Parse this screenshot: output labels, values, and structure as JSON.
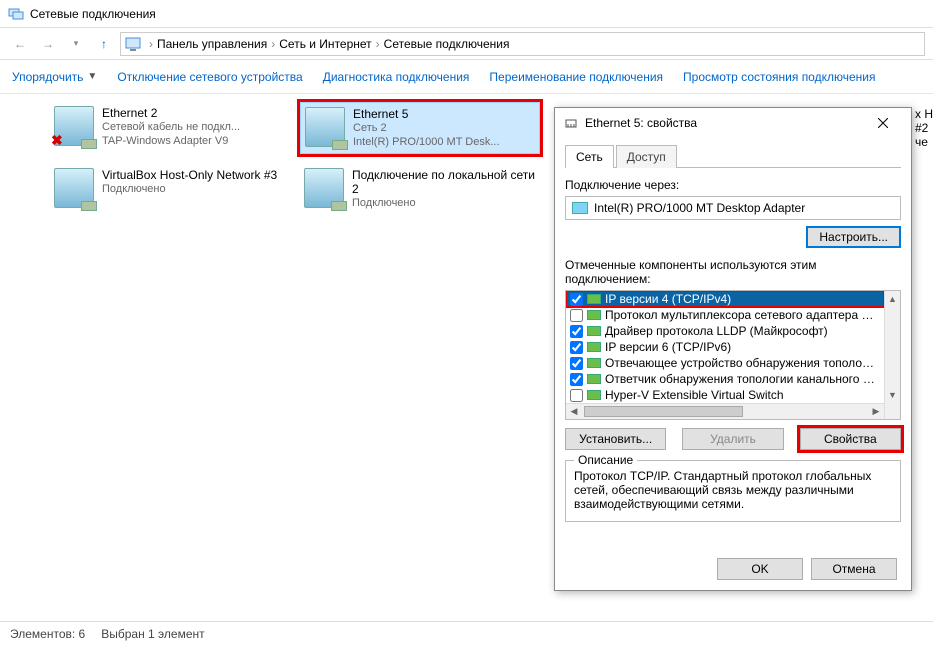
{
  "titlebar": {
    "title": "Сетевые подключения"
  },
  "breadcrumb": {
    "items": [
      "Панель управления",
      "Сеть и Интернет",
      "Сетевые подключения"
    ]
  },
  "cmdbar": {
    "organize": "Упорядочить",
    "disable": "Отключение сетевого устройства",
    "diag": "Диагностика подключения",
    "rename": "Переименование подключения",
    "status": "Просмотр состояния подключения"
  },
  "connections": [
    {
      "name": "Ethernet 2",
      "line2": "Сетевой кабель не подкл...",
      "line3": "TAP-Windows Adapter V9",
      "error": true
    },
    {
      "name": "Ethernet 5",
      "line2": "Сеть 2",
      "line3": "Intel(R) PRO/1000 MT Desk...",
      "selected": true,
      "highlight": true
    },
    {
      "name": "VirtualBox Host-Only Network #3",
      "line2": "Подключено",
      "line3": ""
    },
    {
      "name": "Подключение по локальной сети 2",
      "line2": "Подключено",
      "line3": ""
    }
  ],
  "fragment": {
    "l1": "x H",
    "l2": "#2",
    "l3": "че"
  },
  "statusbar": {
    "count": "Элементов: 6",
    "sel": "Выбран 1 элемент"
  },
  "dialog": {
    "title": "Ethernet 5: свойства",
    "tabs": {
      "net": "Сеть",
      "access": "Доступ"
    },
    "conn_via": "Подключение через:",
    "adapter": "Intel(R) PRO/1000 MT Desktop Adapter",
    "configure": "Настроить...",
    "comp_label": "Отмеченные компоненты используются этим подключением:",
    "components": [
      {
        "label": "IP версии 4 (TCP/IPv4)",
        "checked": true,
        "selected": true
      },
      {
        "label": "Протокол мультиплексора сетевого адаптера (Ма",
        "checked": false
      },
      {
        "label": "Драйвер протокола LLDP (Майкрософт)",
        "checked": true
      },
      {
        "label": "IP версии 6 (TCP/IPv6)",
        "checked": true
      },
      {
        "label": "Отвечающее устройство обнаружения топологии к",
        "checked": true
      },
      {
        "label": "Ответчик обнаружения топологии канального уро",
        "checked": true
      },
      {
        "label": "Hyper-V Extensible Virtual Switch",
        "checked": false
      }
    ],
    "install": "Установить...",
    "remove": "Удалить",
    "properties": "Свойства",
    "desc_legend": "Описание",
    "desc_body": "Протокол TCP/IP. Стандартный протокол глобальных сетей, обеспечивающий связь между различными взаимодействующими сетями.",
    "ok": "OK",
    "cancel": "Отмена"
  }
}
